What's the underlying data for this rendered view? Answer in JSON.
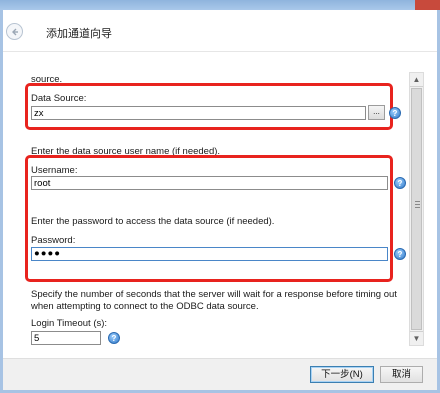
{
  "window": {
    "title": "添加通道向导"
  },
  "form": {
    "source_tail": "source.",
    "data_source": {
      "label": "Data Source:",
      "value": "zx",
      "browse_label": "..."
    },
    "username_hint": "Enter the data source user name (if needed).",
    "username": {
      "label": "Username:",
      "value": "root"
    },
    "password_hint": "Enter the password to access the data source (if needed).",
    "password": {
      "label": "Password:",
      "value": "●●●●"
    },
    "timeout_hint_line1": "Specify the number of seconds that the server will wait for a response before timing out",
    "timeout_hint_line2": "when attempting to connect to the ODBC data source.",
    "login_timeout": {
      "label": "Login Timeout (s):",
      "value": "5"
    }
  },
  "help_glyph": "?",
  "scrollbar": {
    "up": "▲",
    "down": "▼"
  },
  "footer": {
    "next_label": "下一步(N)",
    "cancel_label": "取消"
  },
  "colors": {
    "highlight": "#e8231e",
    "frame": "#a7c3e4",
    "help": "#2f78c7"
  },
  "icons": {
    "back": "back-arrow-icon",
    "help": "help-icon"
  }
}
